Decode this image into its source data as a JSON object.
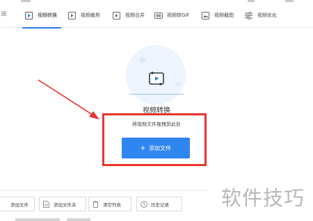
{
  "toolbar": {
    "back_label": "回",
    "tabs": [
      {
        "label": "视频转换",
        "icon": "play-icon",
        "active": true
      },
      {
        "label": "视频裁剪",
        "icon": "video-crop-icon",
        "active": false
      },
      {
        "label": "视频合并",
        "icon": "video-merge-icon",
        "active": false
      },
      {
        "label": "视频转GIF",
        "icon": "gif-icon",
        "active": false
      },
      {
        "label": "视频截图",
        "icon": "screenshot-icon",
        "active": false
      },
      {
        "label": "视频优化",
        "icon": "sliders-icon",
        "active": false
      }
    ]
  },
  "main": {
    "title": "视频转换",
    "hint": "将视频文件拖拽到此处",
    "add_button": {
      "plus": "+",
      "label": "添加文件"
    }
  },
  "bottom_bar": {
    "buttons": [
      {
        "label": "添加文件",
        "icon": "add-file-icon"
      },
      {
        "label": "添加文件夹",
        "icon": "add-folder-icon"
      },
      {
        "label": "清空列表",
        "icon": "trash-icon"
      },
      {
        "label": "历史记录",
        "icon": "clock-icon"
      }
    ]
  },
  "watermark": "软件技巧",
  "colors": {
    "accent": "#2f86f0",
    "highlight_box": "#e8332d",
    "hero_bg": "#eef4fd"
  }
}
